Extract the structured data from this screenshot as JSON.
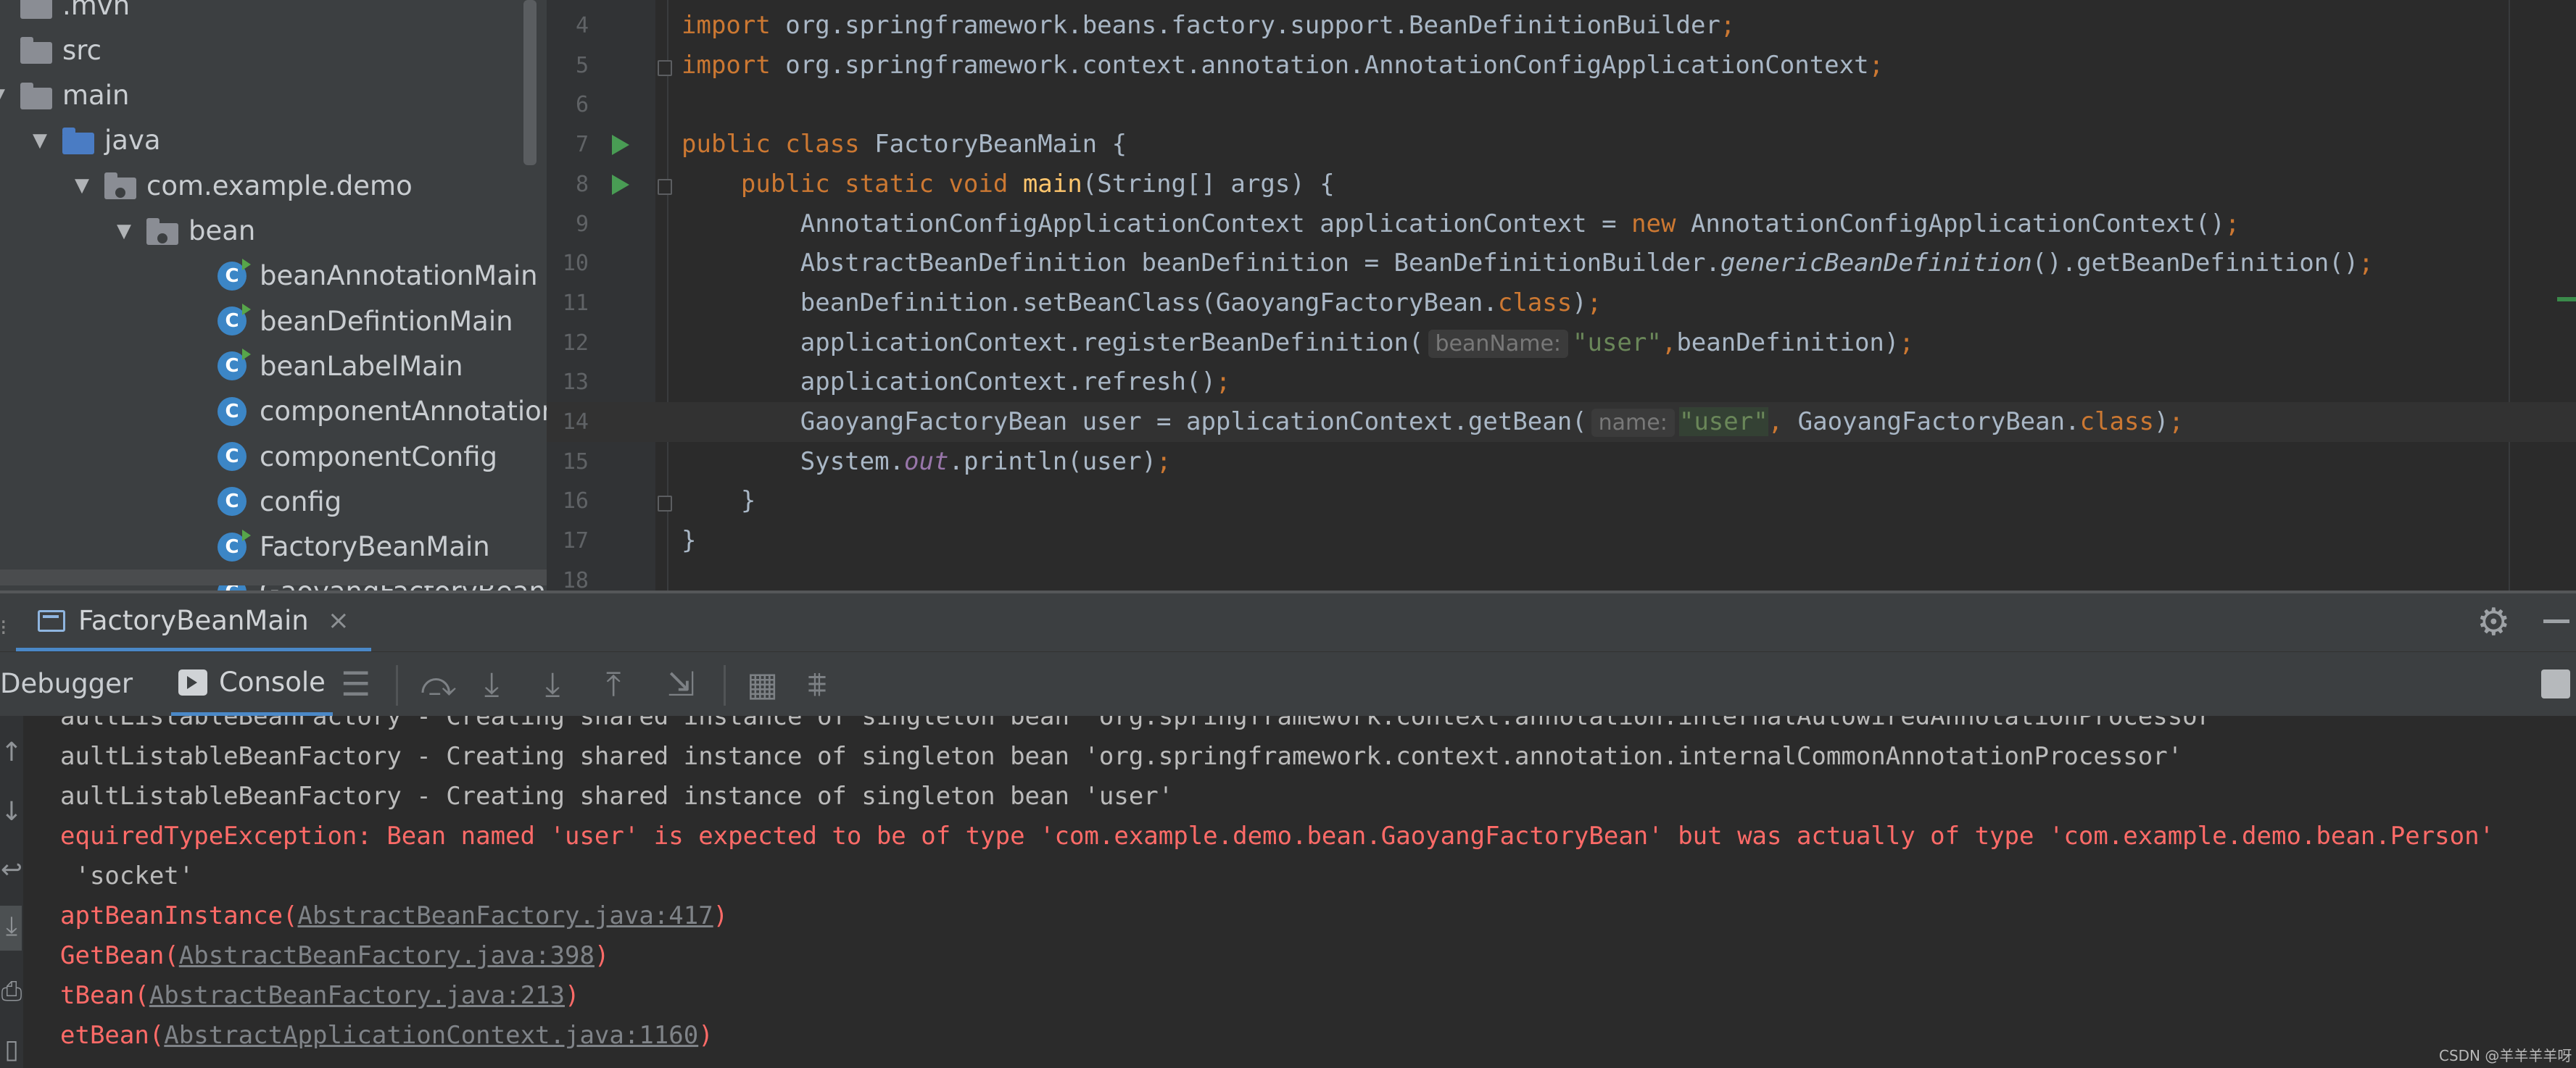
{
  "project_tree": {
    "items": [
      {
        "label": ".mvn",
        "type": "folder",
        "arrow": ""
      },
      {
        "label": "src",
        "type": "folder",
        "arrow": ""
      },
      {
        "label": "main",
        "type": "folder",
        "arrow": "▼"
      },
      {
        "label": "java",
        "type": "folder-blue",
        "arrow": "▼"
      },
      {
        "label": "com.example.demo",
        "type": "package",
        "arrow": "▼"
      },
      {
        "label": "bean",
        "type": "package",
        "arrow": "▼"
      },
      {
        "label": "beanAnnotationMain",
        "type": "class-run",
        "arrow": ""
      },
      {
        "label": "beanDefintionMain",
        "type": "class-run",
        "arrow": ""
      },
      {
        "label": "beanLabelMain",
        "type": "class-run",
        "arrow": ""
      },
      {
        "label": "componentAnnotationM",
        "type": "class",
        "arrow": ""
      },
      {
        "label": "componentConfig",
        "type": "class",
        "arrow": ""
      },
      {
        "label": "config",
        "type": "class",
        "arrow": ""
      },
      {
        "label": "FactoryBeanMain",
        "type": "class-run",
        "arrow": ""
      },
      {
        "label": "GaoyangFactoryBean",
        "type": "class",
        "arrow": ""
      }
    ],
    "class_icon_letter": "C"
  },
  "editor": {
    "lines": [
      {
        "n": "4",
        "parts": [
          [
            "kw",
            "import "
          ],
          [
            "",
            "org.springframework.beans.factory.support.BeanDefinitionBuilder"
          ],
          [
            "kw",
            ";"
          ]
        ]
      },
      {
        "n": "5",
        "parts": [
          [
            "kw",
            "import "
          ],
          [
            "",
            "org.springframework.context.annotation.AnnotationConfigApplicationContext"
          ],
          [
            "kw",
            ";"
          ]
        ]
      },
      {
        "n": "6",
        "parts": []
      },
      {
        "n": "7",
        "parts": [
          [
            "kw",
            "public class "
          ],
          [
            "",
            "FactoryBeanMain {"
          ]
        ]
      },
      {
        "n": "8",
        "parts": [
          [
            "",
            "    "
          ],
          [
            "kw",
            "public static void "
          ],
          [
            "fn",
            "main"
          ],
          [
            "",
            "(String[] args) {"
          ]
        ]
      },
      {
        "n": "9",
        "parts": [
          [
            "",
            "        AnnotationConfigApplicationContext applicationContext = "
          ],
          [
            "kw",
            "new "
          ],
          [
            "",
            "AnnotationConfigApplicationContext()"
          ],
          [
            "kw",
            ";"
          ]
        ]
      },
      {
        "n": "10",
        "parts": [
          [
            "",
            "        AbstractBeanDefinition beanDefinition = BeanDefinitionBuilder."
          ],
          [
            "it",
            "genericBeanDefinition"
          ],
          [
            "",
            "().getBeanDefinition()"
          ],
          [
            "kw",
            ";"
          ]
        ]
      },
      {
        "n": "11",
        "parts": [
          [
            "",
            "        beanDefinition.setBeanClass(GaoyangFactoryBean."
          ],
          [
            "kw",
            "class"
          ],
          [
            "",
            ")"
          ],
          [
            "kw",
            ";"
          ]
        ]
      },
      {
        "n": "12",
        "parts": [
          [
            "",
            "        applicationContext.registerBeanDefinition("
          ],
          [
            "hint",
            "beanName:"
          ],
          [
            "str",
            "\"user\""
          ],
          [
            "kw",
            ","
          ],
          [
            "",
            "beanDefinition)"
          ],
          [
            "kw",
            ";"
          ]
        ]
      },
      {
        "n": "13",
        "parts": [
          [
            "",
            "        applicationContext.refresh()"
          ],
          [
            "kw",
            ";"
          ]
        ]
      },
      {
        "n": "14",
        "parts": [
          [
            "",
            "        GaoyangFactoryBean user = applicationContext.getBean("
          ],
          [
            "hint",
            "name:"
          ],
          [
            "str-sel",
            "\"user\""
          ],
          [
            "kw",
            ", "
          ],
          [
            "",
            "GaoyangFactoryBean."
          ],
          [
            "kw",
            "class"
          ],
          [
            "",
            ")"
          ],
          [
            "kw",
            ";"
          ]
        ]
      },
      {
        "n": "15",
        "parts": [
          [
            "",
            "        System."
          ],
          [
            "static",
            "out"
          ],
          [
            "",
            ".println(user)"
          ],
          [
            "kw",
            ";"
          ]
        ]
      },
      {
        "n": "16",
        "parts": [
          [
            "",
            "    }"
          ]
        ]
      },
      {
        "n": "17",
        "parts": [
          [
            "",
            "}"
          ]
        ]
      },
      {
        "n": "18",
        "parts": []
      }
    ]
  },
  "run_tab": {
    "label": "FactoryBeanMain",
    "close": "×"
  },
  "toolbar": {
    "debugger": "Debugger",
    "console": "Console"
  },
  "console": {
    "lines": [
      {
        "kind": "normal",
        "text": "aultListableBeanFactory - Creating shared instance of singleton bean 'org.springframework.context.annotation.internalAutowiredAnnotationProcessor'"
      },
      {
        "kind": "normal",
        "text": "aultListableBeanFactory - Creating shared instance of singleton bean 'org.springframework.context.annotation.internalCommonAnnotationProcessor'"
      },
      {
        "kind": "normal",
        "text": "aultListableBeanFactory - Creating shared instance of singleton bean 'user'"
      },
      {
        "kind": "err",
        "text": "equiredTypeException: Bean named 'user' is expected to be of type 'com.example.demo.bean.GaoyangFactoryBean' but was actually of type 'com.example.demo.bean.Person'"
      },
      {
        "kind": "normal",
        "text": " 'socket'"
      },
      {
        "kind": "trace",
        "prefix": "aptBeanInstance(",
        "link": "AbstractBeanFactory.java:417",
        "suffix": ")"
      },
      {
        "kind": "trace",
        "prefix": "GetBean(",
        "link": "AbstractBeanFactory.java:398",
        "suffix": ")"
      },
      {
        "kind": "trace",
        "prefix": "tBean(",
        "link": "AbstractBeanFactory.java:213",
        "suffix": ")"
      },
      {
        "kind": "trace",
        "prefix": "etBean(",
        "link": "AbstractApplicationContext.java:1160",
        "suffix": ")"
      }
    ]
  },
  "watermark": "CSDN @羊羊羊羊呀",
  "colors": {
    "keyword": "#cc7832",
    "string": "#6a8759",
    "function": "#ffc66d",
    "error": "#ff6b68",
    "accent": "#4a88c7"
  }
}
